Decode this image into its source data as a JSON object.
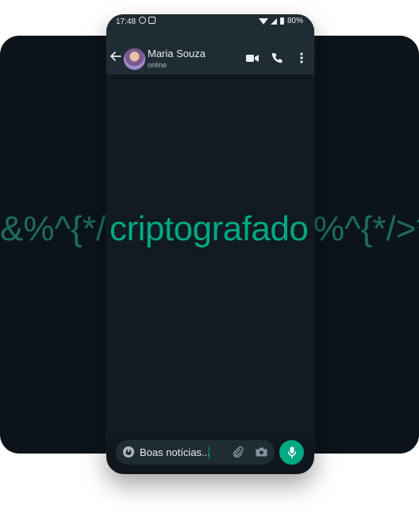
{
  "status_bar": {
    "time": "17:48",
    "battery": "80%"
  },
  "header": {
    "contact_name": "Maria Souza",
    "contact_status": "online"
  },
  "banner": {
    "left_scramble": "&%^{*/",
    "word": "criptografado",
    "right_scramble": "%^{*/>*&"
  },
  "composer": {
    "message_text": "Boas notícias..."
  },
  "icons": {
    "back": "arrow-left-icon",
    "video": "video-camera-icon",
    "call": "phone-icon",
    "menu": "more-vertical-icon",
    "emoji": "emoji-icon",
    "attach": "paperclip-icon",
    "camera": "camera-icon",
    "mic": "microphone-icon"
  },
  "colors": {
    "accent": "#00a884",
    "background": "#0b141a",
    "header": "#1f2c34",
    "chat": "#101a20"
  }
}
